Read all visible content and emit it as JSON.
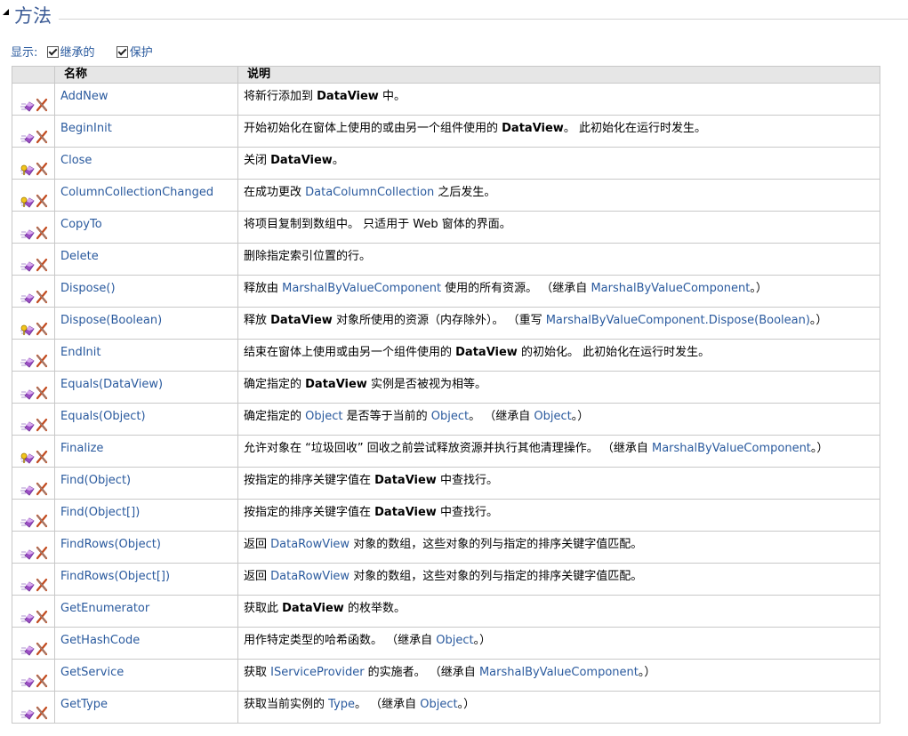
{
  "section": {
    "title": "方法"
  },
  "filter": {
    "label": "显示:",
    "options": [
      {
        "label": "继承的",
        "checked": true
      },
      {
        "label": "保护",
        "checked": true
      }
    ]
  },
  "table": {
    "headers": {
      "icon": "",
      "name": "名称",
      "description": "说明"
    },
    "rows": [
      {
        "kind": "public",
        "name": "AddNew",
        "desc": [
          {
            "t": "将新行添加到 "
          },
          {
            "t": "DataView",
            "b": true
          },
          {
            "t": " 中。"
          }
        ]
      },
      {
        "kind": "public",
        "name": "BeginInit",
        "desc": [
          {
            "t": "开始初始化在窗体上使用的或由另一个组件使用的 "
          },
          {
            "t": "DataView",
            "b": true
          },
          {
            "t": "。 此初始化在运行时发生。"
          }
        ]
      },
      {
        "kind": "protected",
        "name": "Close",
        "desc": [
          {
            "t": "关闭 "
          },
          {
            "t": "DataView",
            "b": true
          },
          {
            "t": "。"
          }
        ]
      },
      {
        "kind": "protected",
        "name": "ColumnCollectionChanged",
        "desc": [
          {
            "t": "在成功更改 "
          },
          {
            "t": "DataColumnCollection",
            "l": true
          },
          {
            "t": " 之后发生。"
          }
        ]
      },
      {
        "kind": "public",
        "name": "CopyTo",
        "desc": [
          {
            "t": "将项目复制到数组中。 只适用于 Web 窗体的界面。"
          }
        ]
      },
      {
        "kind": "public",
        "name": "Delete",
        "desc": [
          {
            "t": "删除指定索引位置的行。"
          }
        ]
      },
      {
        "kind": "public",
        "name": "Dispose()",
        "desc": [
          {
            "t": "释放由 "
          },
          {
            "t": "MarshalByValueComponent",
            "l": true
          },
          {
            "t": " 使用的所有资源。 （继承自 "
          },
          {
            "t": "MarshalByValueComponent",
            "l": true
          },
          {
            "t": "。）"
          }
        ]
      },
      {
        "kind": "protected",
        "name": "Dispose(Boolean)",
        "desc": [
          {
            "t": "释放 "
          },
          {
            "t": "DataView",
            "b": true
          },
          {
            "t": " 对象所使用的资源（内存除外）。 （重写 "
          },
          {
            "t": "MarshalByValueComponent.Dispose(Boolean)",
            "l": true
          },
          {
            "t": "。）"
          }
        ]
      },
      {
        "kind": "public",
        "name": "EndInit",
        "desc": [
          {
            "t": "结束在窗体上使用或由另一个组件使用的 "
          },
          {
            "t": "DataView",
            "b": true
          },
          {
            "t": " 的初始化。 此初始化在运行时发生。"
          }
        ]
      },
      {
        "kind": "public",
        "name": "Equals(DataView)",
        "desc": [
          {
            "t": "确定指定的 "
          },
          {
            "t": "DataView",
            "b": true
          },
          {
            "t": " 实例是否被视为相等。"
          }
        ]
      },
      {
        "kind": "public",
        "name": "Equals(Object)",
        "desc": [
          {
            "t": "确定指定的 "
          },
          {
            "t": "Object",
            "l": true
          },
          {
            "t": " 是否等于当前的 "
          },
          {
            "t": "Object",
            "l": true
          },
          {
            "t": "。 （继承自 "
          },
          {
            "t": "Object",
            "l": true
          },
          {
            "t": "。）"
          }
        ]
      },
      {
        "kind": "protected",
        "name": "Finalize",
        "desc": [
          {
            "t": "允许对象在 “垃圾回收” 回收之前尝试释放资源并执行其他清理操作。 （继承自 "
          },
          {
            "t": "MarshalByValueComponent",
            "l": true
          },
          {
            "t": "。）"
          }
        ]
      },
      {
        "kind": "public",
        "name": "Find(Object)",
        "desc": [
          {
            "t": "按指定的排序关键字值在 "
          },
          {
            "t": "DataView",
            "b": true
          },
          {
            "t": " 中查找行。"
          }
        ]
      },
      {
        "kind": "public",
        "name": "Find(Object[])",
        "desc": [
          {
            "t": "按指定的排序关键字值在 "
          },
          {
            "t": "DataView",
            "b": true
          },
          {
            "t": " 中查找行。"
          }
        ]
      },
      {
        "kind": "public",
        "name": "FindRows(Object)",
        "desc": [
          {
            "t": "返回 "
          },
          {
            "t": "DataRowView",
            "l": true
          },
          {
            "t": " 对象的数组，这些对象的列与指定的排序关键字值匹配。"
          }
        ]
      },
      {
        "kind": "public",
        "name": "FindRows(Object[])",
        "desc": [
          {
            "t": "返回 "
          },
          {
            "t": "DataRowView",
            "l": true
          },
          {
            "t": " 对象的数组，这些对象的列与指定的排序关键字值匹配。"
          }
        ]
      },
      {
        "kind": "public",
        "name": "GetEnumerator",
        "desc": [
          {
            "t": "获取此 "
          },
          {
            "t": "DataView",
            "b": true
          },
          {
            "t": " 的枚举数。"
          }
        ]
      },
      {
        "kind": "public",
        "name": "GetHashCode",
        "desc": [
          {
            "t": "用作特定类型的哈希函数。 （继承自 "
          },
          {
            "t": "Object",
            "l": true
          },
          {
            "t": "。）"
          }
        ]
      },
      {
        "kind": "public",
        "name": "GetService",
        "desc": [
          {
            "t": "获取 "
          },
          {
            "t": "IServiceProvider",
            "l": true
          },
          {
            "t": " 的实施者。 （继承自 "
          },
          {
            "t": "MarshalByValueComponent",
            "l": true
          },
          {
            "t": "。）"
          }
        ]
      },
      {
        "kind": "public",
        "name": "GetType",
        "desc": [
          {
            "t": "获取当前实例的 "
          },
          {
            "t": "Type",
            "l": true
          },
          {
            "t": "。 （继承自 "
          },
          {
            "t": "Object",
            "l": true
          },
          {
            "t": "。）"
          }
        ]
      }
    ]
  },
  "icons": {
    "public": "public-method-icon",
    "protected": "protected-method-icon",
    "framework": "xna-framework-icon"
  },
  "colors": {
    "link": "#2a5a9e",
    "header_bg": "#e6e6e6",
    "title": "#3a5a95",
    "grid": "#c8c8c8"
  }
}
